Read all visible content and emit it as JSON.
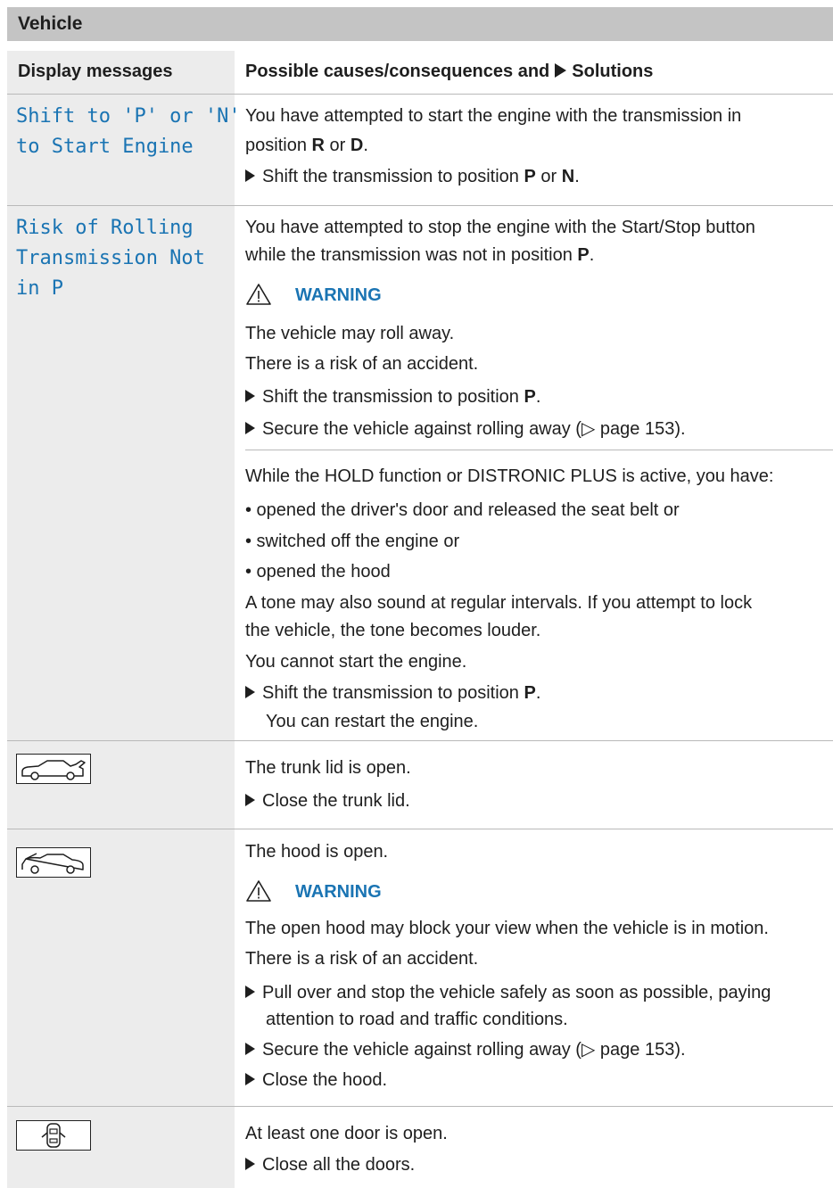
{
  "section_title": "Vehicle",
  "table_header": {
    "col1": "Display messages",
    "col2_prefix": "Possible causes/consequences and",
    "col2_suffix": "Solutions"
  },
  "rows": {
    "shift": {
      "message": "Shift to 'P' or 'N'\nto Start Engine",
      "cause_a": "You have attempted to start the engine with the transmission in",
      "cause_b1": "position ",
      "cause_b2": "R",
      "cause_b3": " or ",
      "cause_b4": "D",
      "cause_b5": ".",
      "step_a": "Shift the transmission to position ",
      "step_b": "P",
      "step_c": " or ",
      "step_d": "N",
      "step_e": "."
    },
    "rolling": {
      "message": "Risk of Rolling\nTransmission Not\nin P",
      "cause_a": "You have attempted to stop the engine with the Start/Stop button",
      "cause_b1": "while the transmission was not in position ",
      "cause_b2": "P",
      "cause_b3": ".",
      "warning_label": "WARNING",
      "warn_1": "The vehicle may roll away.",
      "warn_2": "There is a risk of an accident.",
      "step1_a": "Shift the transmission to position ",
      "step1_b": "P",
      "step1_c": ".",
      "step2": "Secure the vehicle against rolling away (▷ page 153).",
      "hold_intro": "While the HOLD function or DISTRONIC PLUS is active, you have:",
      "bullet_1": "• opened the driver's door and released the seat belt or",
      "bullet_2": "• switched off the engine or",
      "bullet_3": "• opened the hood",
      "tone_a": "A tone may also sound at regular intervals. If you attempt to lock",
      "tone_b": "the vehicle, the tone becomes louder.",
      "cannot": "You cannot start the engine.",
      "step3_a": "Shift the transmission to position ",
      "step3_b": "P",
      "step3_c": ".",
      "restart": "You can restart the engine."
    },
    "trunk": {
      "icon": "trunk-open-icon",
      "cause": "The trunk lid is open.",
      "step": "Close the trunk lid."
    },
    "hood": {
      "icon": "hood-open-icon",
      "cause": "The hood is open.",
      "warning_label": "WARNING",
      "warn_1": "The open hood may block your view when the vehicle is in motion.",
      "warn_2": "There is a risk of an accident.",
      "step1_a": "Pull over and stop the vehicle safely as soon as possible, paying",
      "step1_b": "attention to road and traffic conditions.",
      "step2": "Secure the vehicle against rolling away (▷ page 153).",
      "step3": "Close the hood."
    },
    "door": {
      "icon": "door-open-icon",
      "cause": "At least one door is open.",
      "step": "Close all the doors."
    }
  },
  "colors": {
    "accent": "#1a74b3",
    "title_bar": "#c4c4c4",
    "left_column": "#ececec",
    "rule": "#b9b9b9"
  }
}
